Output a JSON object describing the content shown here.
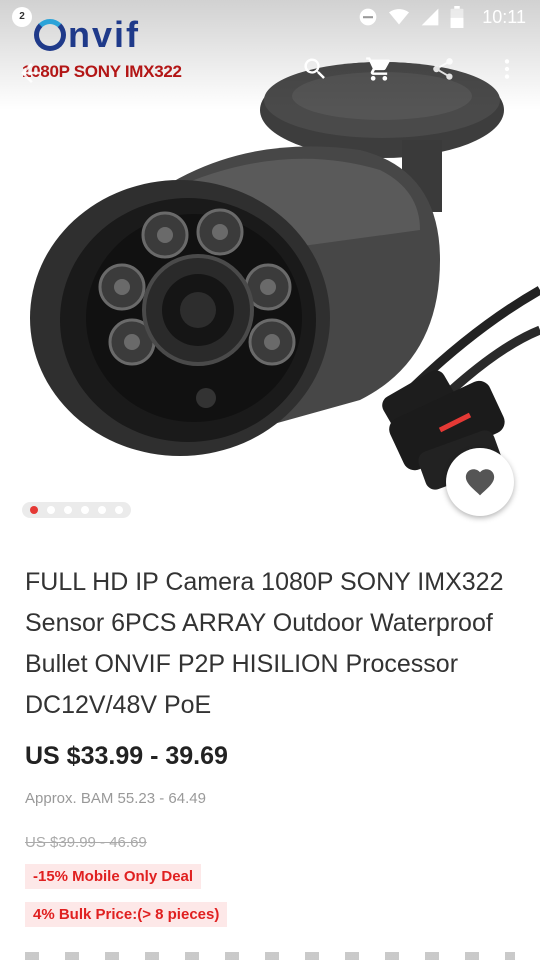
{
  "status_bar": {
    "notification_count": "2",
    "time": "10:11",
    "icons": [
      "minus-circle-icon",
      "wifi-icon",
      "signal-icon",
      "battery-icon"
    ]
  },
  "hero": {
    "brand_logo": "nvif",
    "brand_subtitle": "1080P SONY IMX322",
    "image_description_icon": "ip-bullet-camera-image",
    "carousel": {
      "total": 6,
      "active_index": 0
    }
  },
  "toolbar": {
    "back_icon": "back-arrow-icon",
    "actions": [
      "search-icon",
      "cart-icon",
      "share-icon",
      "more-vert-icon"
    ]
  },
  "product": {
    "title": "FULL HD  IP Camera 1080P SONY IMX322 Sensor 6PCS ARRAY Outdoor Waterproof Bullet ONVIF P2P HISILION Processor DC12V/48V PoE",
    "price": "US $33.99 - 39.69",
    "approx_price": "Approx. BAM 55.23 - 64.49",
    "original_price": "US $39.99 - 46.69",
    "tags": {
      "deal": "-15% Mobile Only Deal",
      "bulk": "4% Bulk Price:(> 8 pieces)"
    }
  },
  "colors": {
    "accent_red": "#e53935",
    "tag_bg": "#fde8e8",
    "tag_text": "#e02020",
    "brand_blue": "#1f3a8a"
  }
}
